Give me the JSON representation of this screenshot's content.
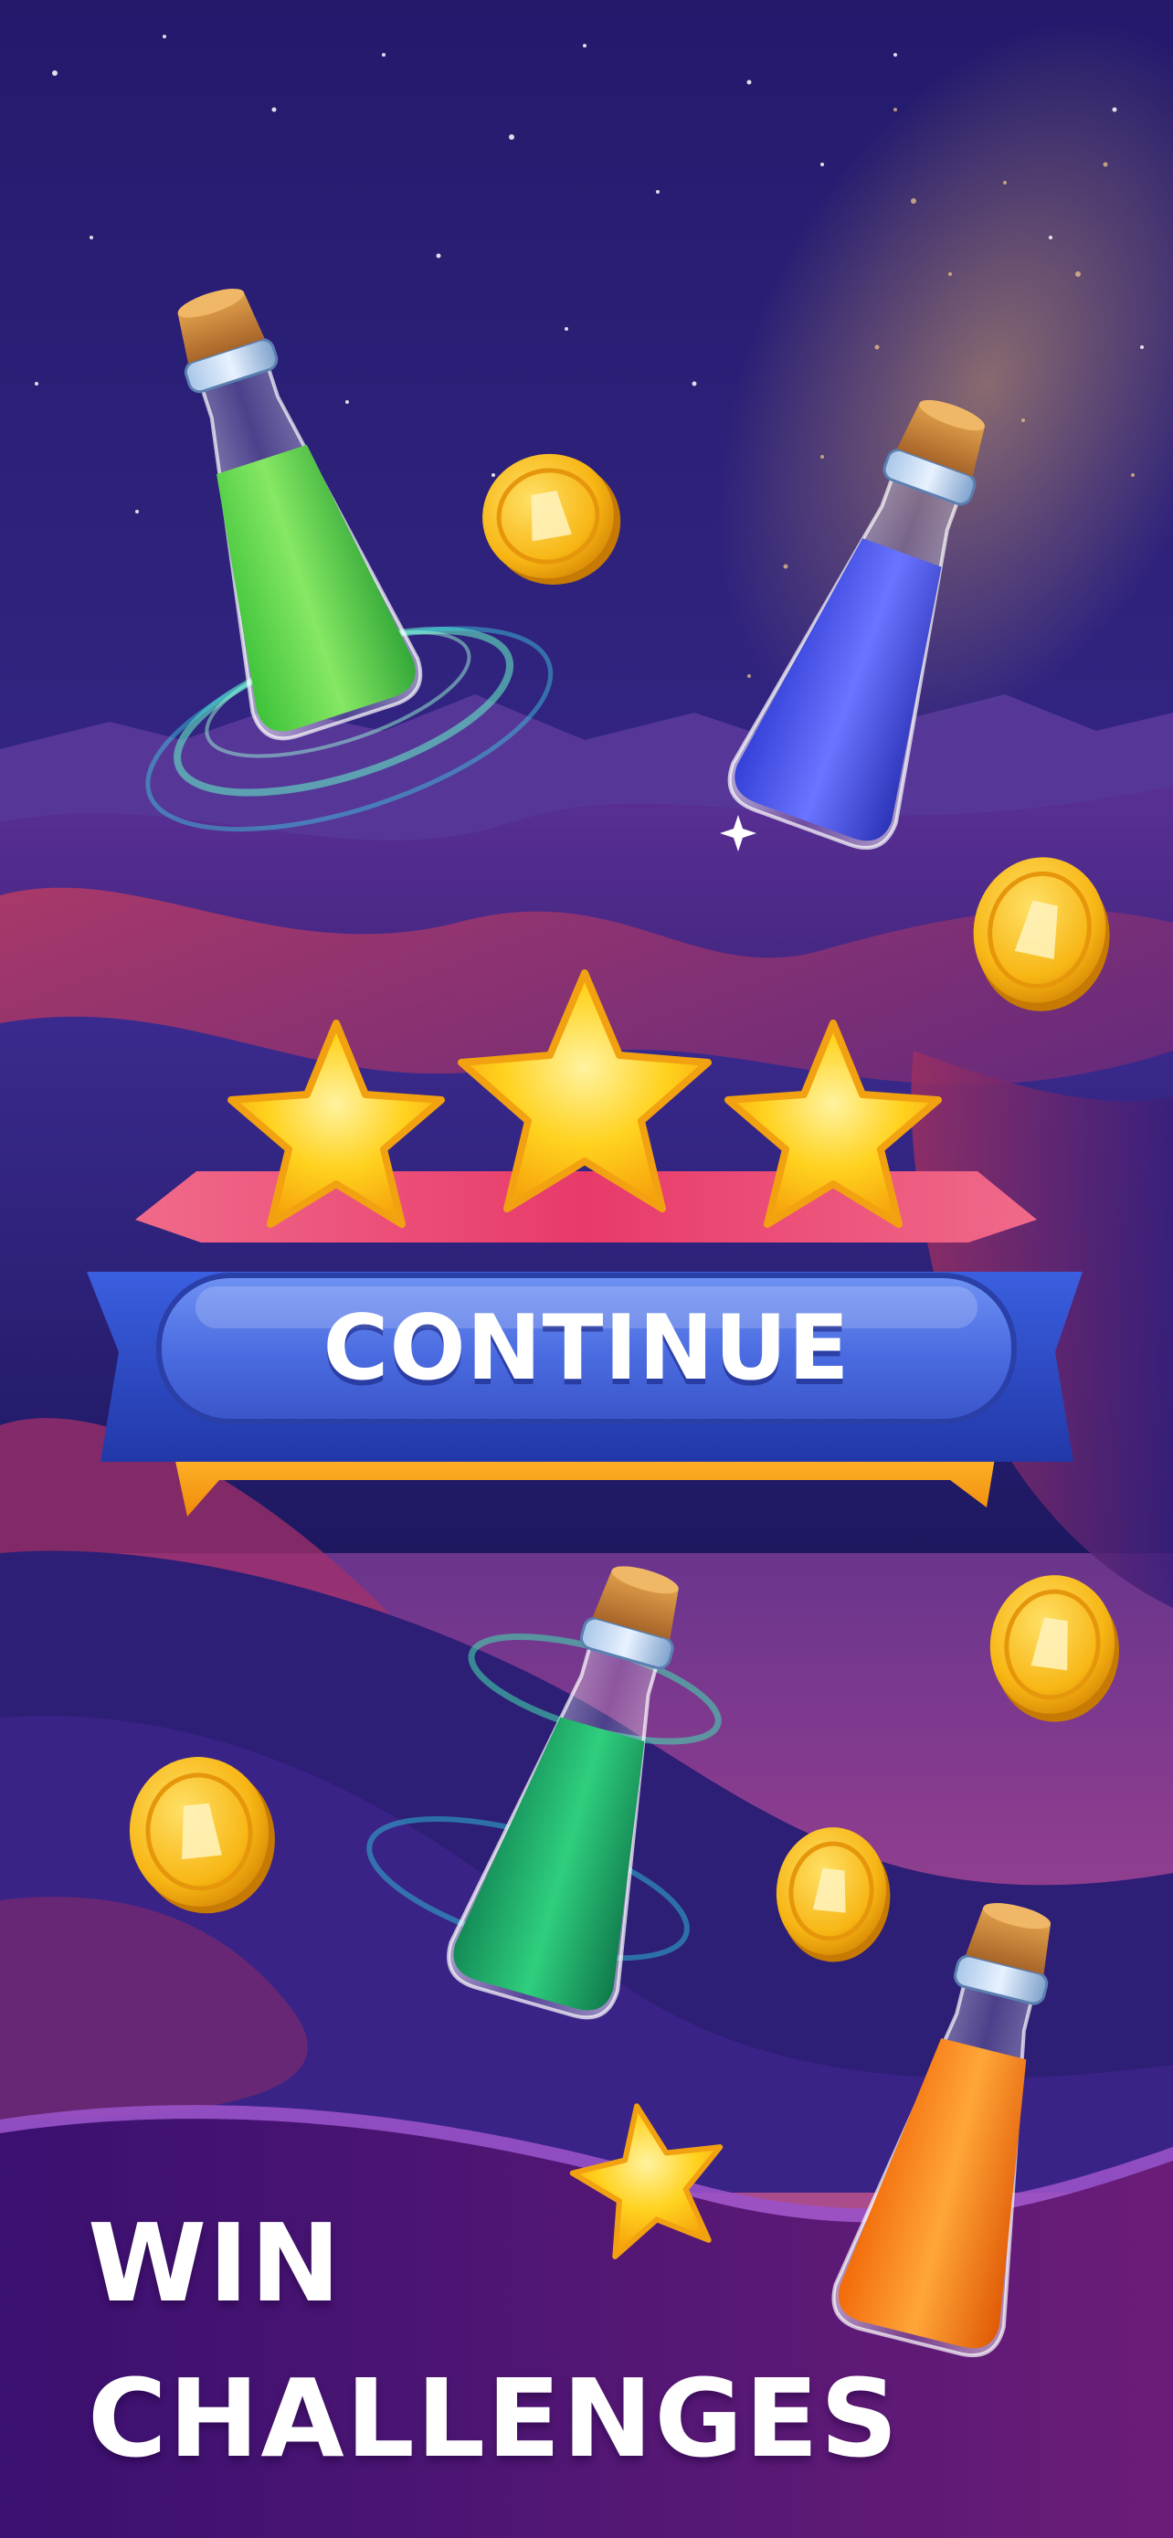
{
  "screen": {
    "button": {
      "label": "CONTINUE"
    },
    "headline": {
      "line1": "WIN",
      "line2": "CHALLENGES"
    },
    "stars_earned": 3,
    "stars_total": 3,
    "bottles": [
      {
        "name": "green-sand-bottle",
        "color": "#5ed24a"
      },
      {
        "name": "blue-sand-bottle",
        "color": "#4a55ef"
      },
      {
        "name": "teal-sand-bottle",
        "color": "#1fae6a"
      },
      {
        "name": "orange-sand-bottle",
        "color": "#ff8a1a"
      }
    ],
    "colors": {
      "sky_top": "#241a6e",
      "sky_horizon": "#b04a8a",
      "dune_dark": "#2a1c6a",
      "dune_red": "#9a2a5c",
      "ribbon_blue": "#2e4fc8",
      "ribbon_pink": "#e8487a",
      "ribbon_orange": "#f5a21a",
      "coin_gold": "#f7b614",
      "star_yellow": "#ffd21e",
      "footer_purple": "#4a1572"
    },
    "icons": [
      "cork-bottle-icon",
      "coin-icon",
      "star-icon",
      "sparkle-icon",
      "swirl-icon"
    ]
  }
}
